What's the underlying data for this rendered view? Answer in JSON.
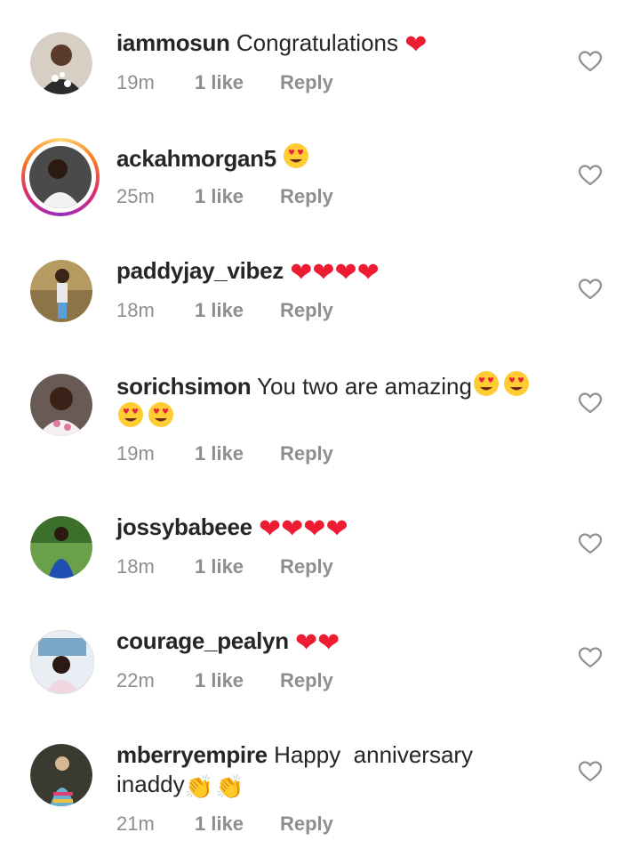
{
  "comments": [
    {
      "username": "iammosun",
      "text": "Congratulations",
      "hearts": 1,
      "emoji_faces": 0,
      "extra_line": "",
      "time": "19m",
      "likes": "1 like",
      "reply": "Reply",
      "has_story_ring": false
    },
    {
      "username": "ackahmorgan5",
      "text": "",
      "hearts": 0,
      "emoji_faces": 1,
      "extra_line": "",
      "time": "25m",
      "likes": "1 like",
      "reply": "Reply",
      "has_story_ring": true
    },
    {
      "username": "paddyjay_vibez",
      "text": "",
      "hearts": 4,
      "emoji_faces": 0,
      "extra_line": "",
      "time": "18m",
      "likes": "1 like",
      "reply": "Reply",
      "has_story_ring": false
    },
    {
      "username": "sorichsimon",
      "text": "You two are amazing",
      "hearts": 0,
      "emoji_faces": 2,
      "extra_line_faces": 2,
      "time": "19m",
      "likes": "1 like",
      "reply": "Reply",
      "has_story_ring": false
    },
    {
      "username": "jossybabeee",
      "text": "",
      "hearts": 4,
      "emoji_faces": 0,
      "extra_line": "",
      "time": "18m",
      "likes": "1 like",
      "reply": "Reply",
      "has_story_ring": false
    },
    {
      "username": "courage_pealyn",
      "text": "",
      "hearts": 2,
      "emoji_faces": 0,
      "extra_line": "",
      "time": "22m",
      "likes": "1 like",
      "reply": "Reply",
      "has_story_ring": false
    },
    {
      "username": "mberryempire",
      "text": "Happy  anniversary",
      "extra_line": "inaddy",
      "claps": 2,
      "time": "21m",
      "likes": "1 like",
      "reply": "Reply",
      "has_story_ring": false
    }
  ],
  "colors": {
    "heart": "#ed1c33",
    "meta": "#8e8e8e",
    "text": "#262626"
  },
  "icons": {
    "like": "heart-outline-icon",
    "heart": "red-heart-emoji",
    "face": "heart-eyes-emoji",
    "clap": "clapping-hands-emoji"
  }
}
